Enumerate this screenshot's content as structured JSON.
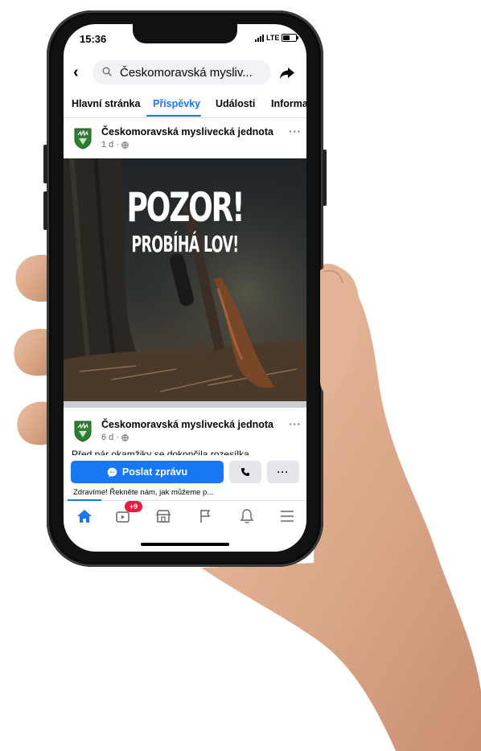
{
  "status_bar": {
    "time": "15:36",
    "network": "LTE"
  },
  "search": {
    "query": "Českomoravská mysliv..."
  },
  "tabs": [
    {
      "label": "Hlavní stránka"
    },
    {
      "label": "Příspěvky"
    },
    {
      "label": "Události"
    },
    {
      "label": "Informa"
    }
  ],
  "posts": [
    {
      "page_name": "Českomoravská myslivecká jednota",
      "meta": "1 d ·",
      "image_text": {
        "title": "POZOR!",
        "subtitle": "PROBÍHÁ LOV!"
      }
    },
    {
      "page_name": "Českomoravská myslivecká jednota",
      "meta": "6 d ·",
      "text": "Před pár okamžiky se dokončila rozesílka"
    }
  ],
  "actions": {
    "message_button": "Poslat zprávu",
    "more_label": "···",
    "greeting": "Zdravíme! Řekněte nám, jak můžeme p..."
  },
  "bottom_nav": {
    "watch_badge": "+9",
    "items": [
      "home-icon",
      "watch-icon",
      "marketplace-icon",
      "flag-icon",
      "bell-icon",
      "menu-icon"
    ]
  },
  "colors": {
    "facebook_blue": "#1877f2",
    "badge_red": "#e41e3f"
  }
}
